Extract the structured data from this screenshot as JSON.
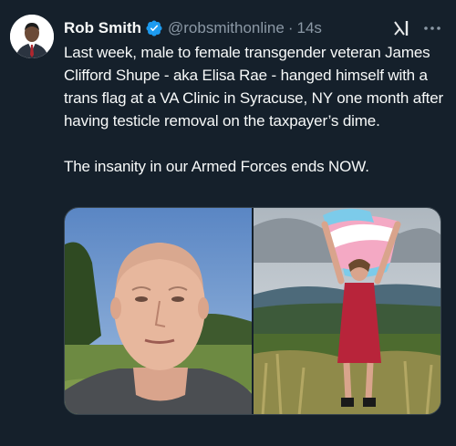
{
  "tweet": {
    "display_name": "Rob Smith",
    "handle": "@robsmithonline",
    "separator": "·",
    "time": "14s",
    "verified_icon": "verified-badge-icon",
    "paragraphs": [
      "Last week, male to female transgender veteran James Clifford Shupe - aka Elisa Rae - hanged himself with a trans flag at a VA Clinic in Syracuse, NY one month after having testicle removal on the taxpayer’s dime.",
      "The insanity in our Armed Forces ends NOW."
    ],
    "media": [
      {
        "alt": "Selfie of a bald man in a gray t-shirt outdoors"
      },
      {
        "alt": "Person in a red dress holding a transgender pride flag overhead on a hilltop"
      }
    ]
  },
  "colors": {
    "background": "#15202b",
    "text": "#f7f9f9",
    "secondary_text": "#8b98a5",
    "verified": "#1d9bf0"
  },
  "icons": [
    "verified-badge-icon",
    "grok-icon",
    "more-options-icon"
  ]
}
